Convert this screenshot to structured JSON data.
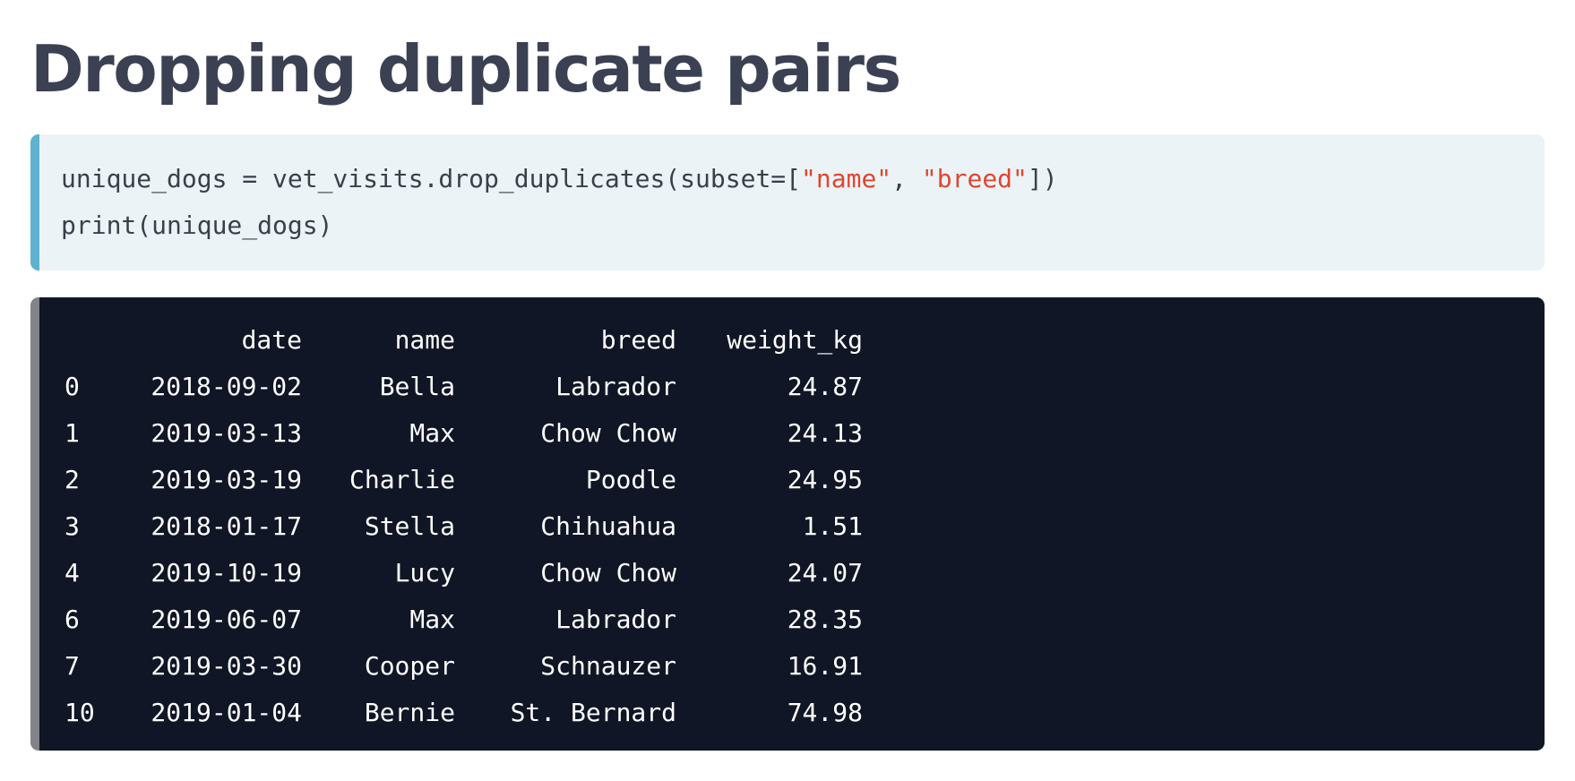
{
  "slide": {
    "title": "Dropping duplicate pairs"
  },
  "code": {
    "line1_pre": "unique_dogs = vet_visits.drop_duplicates(subset=[",
    "str1": "\"name\"",
    "sep": ", ",
    "str2": "\"breed\"",
    "line1_post": "])",
    "line2": "print(unique_dogs)"
  },
  "output": {
    "columns": [
      "",
      "date",
      "name",
      "breed",
      "weight_kg"
    ],
    "rows": [
      [
        "0",
        "2018-09-02",
        "Bella",
        "Labrador",
        "24.87"
      ],
      [
        "1",
        "2019-03-13",
        "Max",
        "Chow Chow",
        "24.13"
      ],
      [
        "2",
        "2019-03-19",
        "Charlie",
        "Poodle",
        "24.95"
      ],
      [
        "3",
        "2018-01-17",
        "Stella",
        "Chihuahua",
        "1.51"
      ],
      [
        "4",
        "2019-10-19",
        "Lucy",
        "Chow Chow",
        "24.07"
      ],
      [
        "6",
        "2019-06-07",
        "Max",
        "Labrador",
        "28.35"
      ],
      [
        "7",
        "2019-03-30",
        "Cooper",
        "Schnauzer",
        "16.91"
      ],
      [
        "10",
        "2019-01-04",
        "Bernie",
        "St. Bernard",
        "74.98"
      ]
    ]
  },
  "colors": {
    "title": "#3b4053",
    "code_bg": "#ebf3f6",
    "code_accent": "#5fb2cf",
    "string": "#e0452e",
    "output_bg": "#101625",
    "output_accent": "#818388"
  }
}
